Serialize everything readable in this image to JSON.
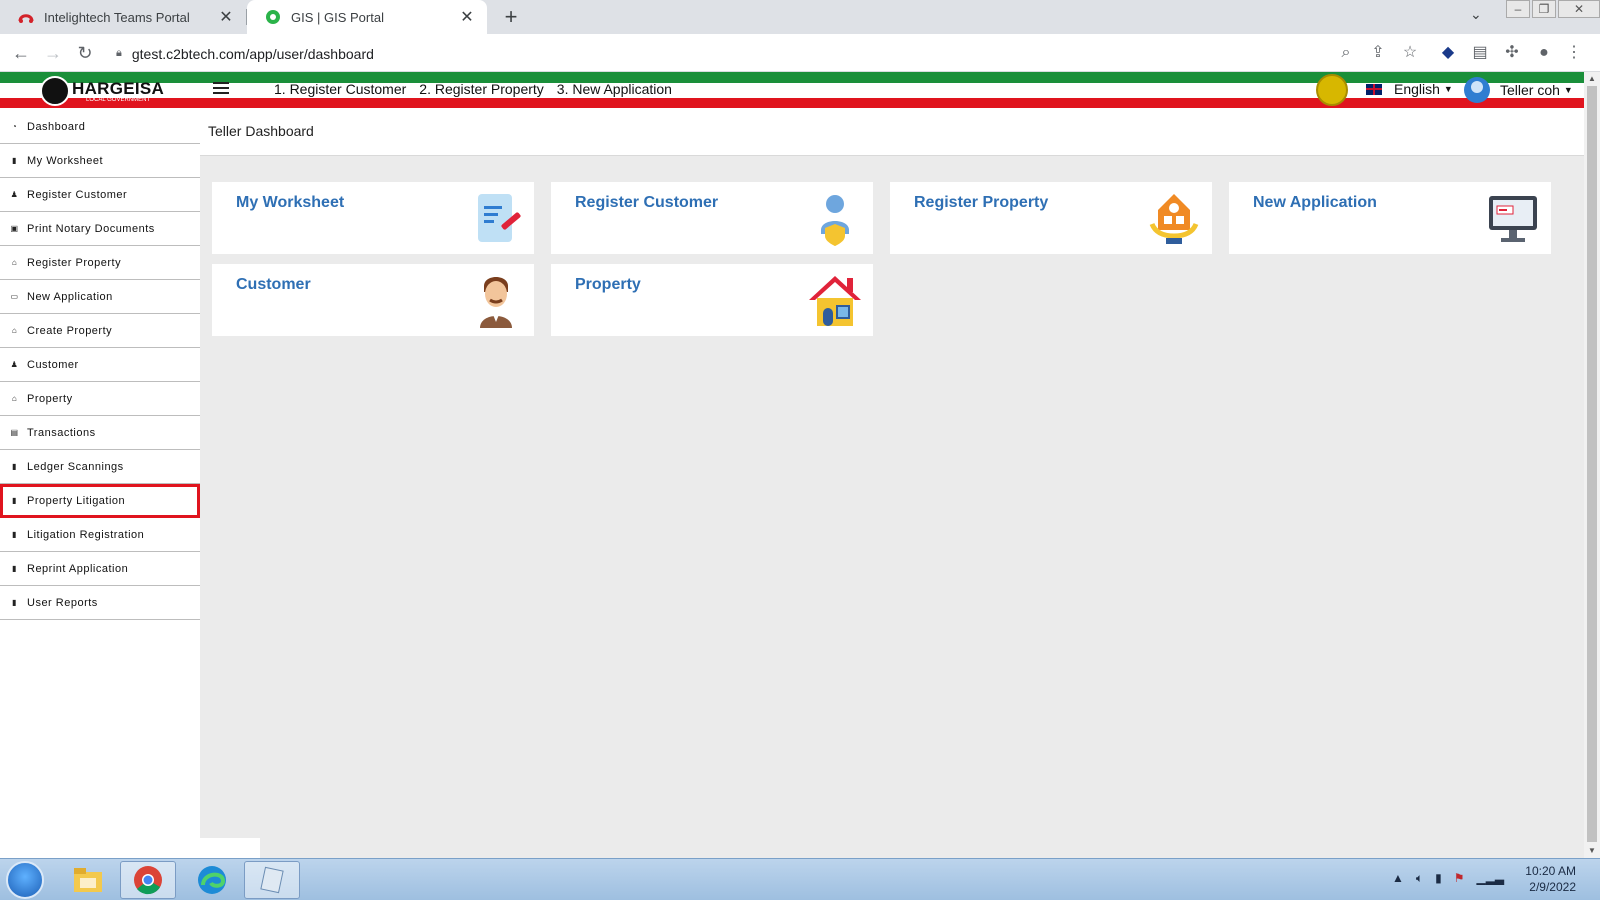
{
  "browser": {
    "tabs": [
      {
        "title": "Intelightech Teams Portal",
        "active": false
      },
      {
        "title": "GIS | GIS Portal",
        "active": true
      }
    ],
    "url": "gtest.c2btech.com/app/user/dashboard"
  },
  "header": {
    "logo_text": "HARGEISA",
    "logo_subtext": "LOCAL GOVERNMENT",
    "quick_links": [
      "1. Register Customer",
      "2. Register Property",
      "3. New Application"
    ],
    "language": "English",
    "user_name": "Teller coh",
    "colors": {
      "green": "#1a8f3a",
      "red": "#e0141e"
    }
  },
  "sidebar": {
    "items": [
      {
        "label": "Dashboard",
        "icon": "dashboard-icon"
      },
      {
        "label": "My Worksheet",
        "icon": "document-icon"
      },
      {
        "label": "Register Customer",
        "icon": "user-icon"
      },
      {
        "label": "Print Notary Documents",
        "icon": "print-icon"
      },
      {
        "label": "Register Property",
        "icon": "home-icon"
      },
      {
        "label": "New Application",
        "icon": "monitor-icon"
      },
      {
        "label": "Create Property",
        "icon": "home-icon"
      },
      {
        "label": "Customer",
        "icon": "user-icon"
      },
      {
        "label": "Property",
        "icon": "home-icon"
      },
      {
        "label": "Transactions",
        "icon": "table-icon"
      },
      {
        "label": "Ledger Scannings",
        "icon": "document-icon"
      },
      {
        "label": "Property Litigation",
        "icon": "document-icon",
        "highlighted": true
      },
      {
        "label": "Litigation Registration",
        "icon": "document-icon"
      },
      {
        "label": "Reprint Application",
        "icon": "document-icon"
      },
      {
        "label": "User Reports",
        "icon": "document-icon"
      }
    ],
    "highlight_color": "#e0141e"
  },
  "main": {
    "breadcrumb": "Teller Dashboard",
    "cards": [
      {
        "label": "My Worksheet",
        "icon": "worksheet-icon"
      },
      {
        "label": "Register Customer",
        "icon": "register-customer-icon"
      },
      {
        "label": "Register Property",
        "icon": "register-property-icon"
      },
      {
        "label": "New Application",
        "icon": "new-application-icon"
      },
      {
        "label": "Customer",
        "icon": "customer-icon"
      },
      {
        "label": "Property",
        "icon": "property-icon"
      }
    ],
    "card_label_color": "#2e6fb4"
  },
  "taskbar": {
    "time": "10:20 AM",
    "date": "2/9/2022"
  }
}
